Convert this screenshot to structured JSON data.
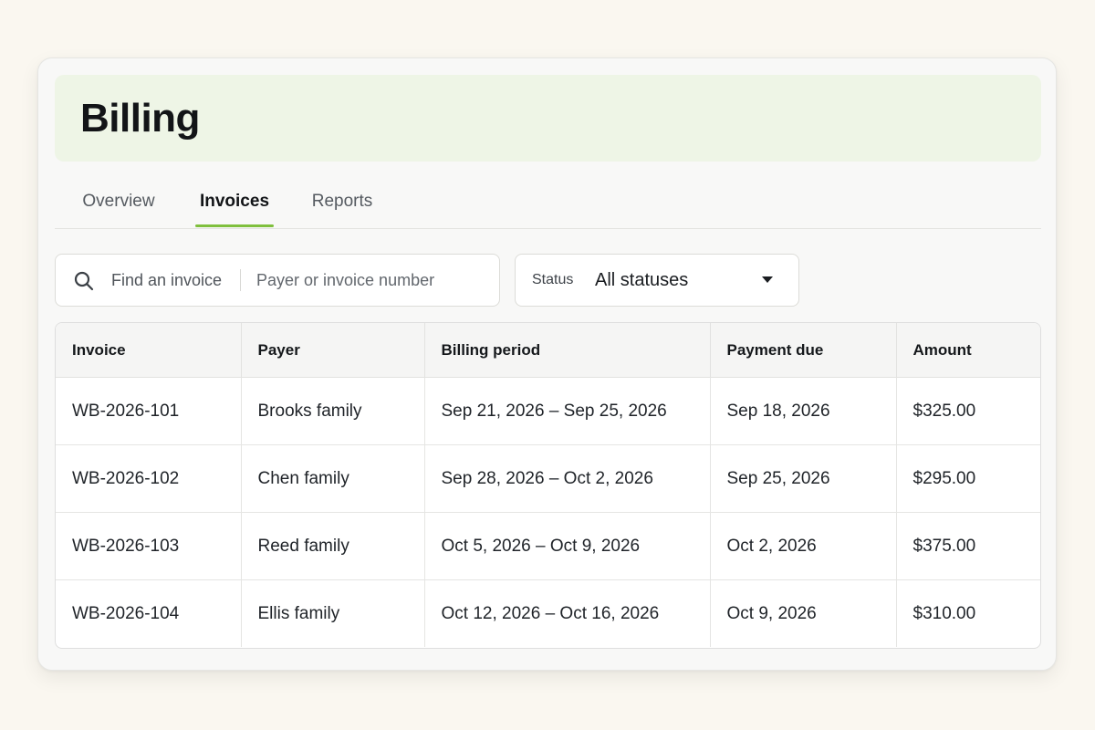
{
  "page": {
    "title": "Billing"
  },
  "tabs": [
    {
      "label": "Overview"
    },
    {
      "label": "Invoices"
    },
    {
      "label": "Reports"
    }
  ],
  "active_tab": "Invoices",
  "search": {
    "label": "Find an invoice",
    "placeholder": "Payer or invoice number",
    "value": ""
  },
  "status_filter": {
    "label": "Status",
    "value": "All statuses"
  },
  "table": {
    "columns": [
      "Invoice",
      "Payer",
      "Billing period",
      "Payment due",
      "Amount"
    ],
    "rows": [
      [
        "WB-2026-101",
        "Brooks family",
        "Sep 21, 2026 – Sep 25, 2026",
        "Sep 18, 2026",
        "$325.00"
      ],
      [
        "WB-2026-102",
        "Chen family",
        "Sep 28, 2026 – Oct 2, 2026",
        "Sep 25, 2026",
        "$295.00"
      ],
      [
        "WB-2026-103",
        "Reed family",
        "Oct 5, 2026 – Oct 9, 2026",
        "Oct 2, 2026",
        "$375.00"
      ],
      [
        "WB-2026-104",
        "Ellis family",
        "Oct 12, 2026 – Oct 16, 2026",
        "Oct 9, 2026",
        "$310.00"
      ]
    ]
  },
  "colors": {
    "header_band": "#eef5e6",
    "accent": "#7fbf3d",
    "background": "#faf7f0"
  },
  "icons": {
    "search": "search-icon",
    "dropdown": "caret-down-icon"
  }
}
